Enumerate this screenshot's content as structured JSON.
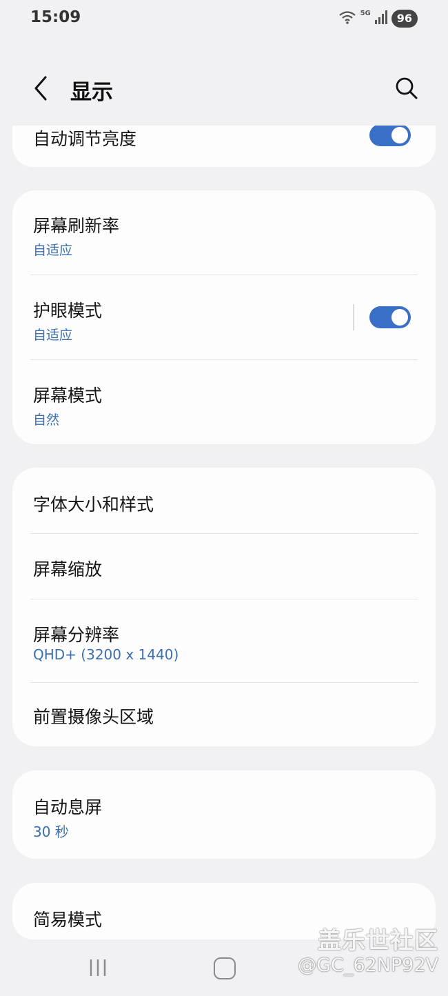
{
  "status_bar": {
    "time": "15:09",
    "network_label": "5G",
    "battery": "96"
  },
  "header": {
    "title": "显示"
  },
  "card0": {
    "auto_brightness_label": "自动调节亮度",
    "auto_brightness_on": true
  },
  "card1": {
    "refresh_rate": {
      "title": "屏幕刷新率",
      "value": "自适应"
    },
    "eye_comfort": {
      "title": "护眼模式",
      "value": "自适应",
      "on": true
    },
    "screen_mode": {
      "title": "屏幕模式",
      "value": "自然"
    }
  },
  "card2": {
    "font": {
      "title": "字体大小和样式"
    },
    "zoom": {
      "title": "屏幕缩放"
    },
    "resolution": {
      "title": "屏幕分辨率",
      "value": "QHD+ (3200 x 1440)"
    },
    "camera_cutout": {
      "title": "前置摄像头区域"
    }
  },
  "card3": {
    "screen_timeout": {
      "title": "自动息屏",
      "value": "30 秒"
    }
  },
  "card4": {
    "easy_mode": {
      "title": "简易模式"
    }
  },
  "watermark": {
    "line1": "盖乐世社区",
    "line2": "@GC_62NP92V"
  },
  "colors": {
    "accent": "#3a6fc8",
    "subtext": "#3a6fb0",
    "background": "#f1f1f4",
    "card": "#fdfdfd"
  }
}
